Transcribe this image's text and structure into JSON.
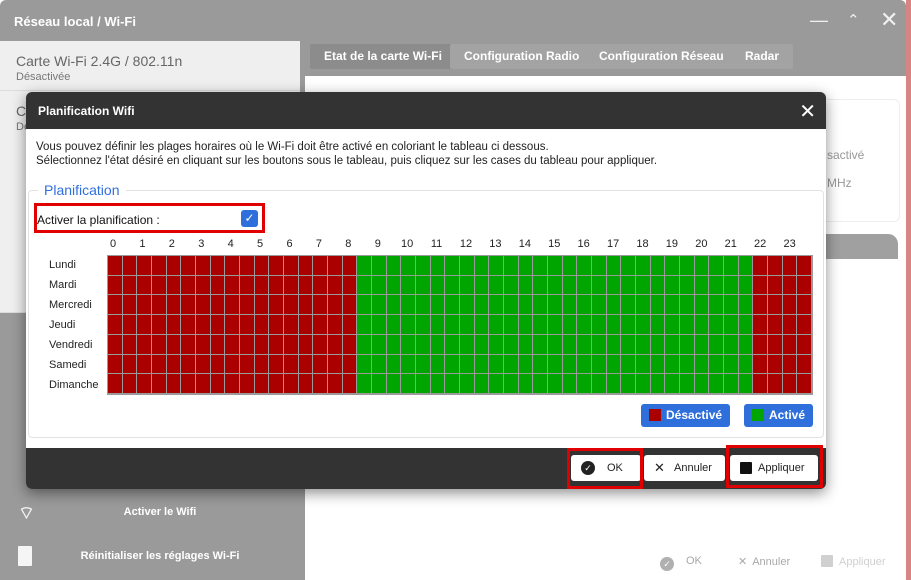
{
  "window": {
    "title": "Réseau local / Wi-Fi",
    "controls": [
      "minimize-icon",
      "restore-icon",
      "close-icon"
    ]
  },
  "sidebar": {
    "items": [
      {
        "title": "Carte Wi-Fi 2.4G / 802.11n",
        "subtitle": "Désactivée"
      },
      {
        "title": "C",
        "subtitle": "De"
      }
    ],
    "actions": [
      {
        "label": "Activer le Wifi",
        "icon": "wifi-off-icon"
      },
      {
        "label": "Réinitialiser les réglages Wi-Fi",
        "icon": "trash-icon"
      }
    ]
  },
  "tabs": [
    {
      "label": "Etat de la carte Wi-Fi",
      "active": true
    },
    {
      "label": "Configuration Radio",
      "active": false
    },
    {
      "label": "Configuration Réseau",
      "active": false
    },
    {
      "label": "Radar",
      "active": false
    }
  ],
  "background_content": {
    "status_fragment": "sactivé",
    "freq_fragment": "MHz",
    "footer": {
      "ok": "OK",
      "cancel": "Annuler",
      "apply": "Appliquer"
    }
  },
  "modal": {
    "title": "Planification Wifi",
    "description_line1": "Vous pouvez définir les plages horaires où le Wi-Fi doit être activé en coloriant le tableau ci dessous.",
    "description_line2": "Sélectionnez l'état désiré en cliquant sur les boutons sous le tableau, puis cliquez sur les cases du tableau pour appliquer.",
    "section_title": "Planification",
    "enable_label": "Activer la planification :",
    "enable_checked": true,
    "hours": [
      "0",
      "1",
      "2",
      "3",
      "4",
      "5",
      "6",
      "7",
      "8",
      "9",
      "10",
      "11",
      "12",
      "13",
      "14",
      "15",
      "16",
      "17",
      "18",
      "19",
      "20",
      "21",
      "22",
      "23"
    ],
    "days": [
      "Lundi",
      "Mardi",
      "Mercredi",
      "Jeudi",
      "Vendredi",
      "Samedi",
      "Dimanche"
    ],
    "slots_per_hour": 2,
    "schedule": {
      "description": "Same schedule every day: disabled 00:00–08:30, enabled 08:30–22:00, disabled 22:00–24:00",
      "enabled_ranges": [
        [
          8.5,
          22.0
        ]
      ]
    },
    "colors": {
      "disabled": "#aa0000",
      "enabled": "#00a500",
      "accent": "#2f6fdc"
    },
    "state_buttons": {
      "disabled": "Désactivé",
      "enabled": "Activé"
    },
    "footer": {
      "ok": "OK",
      "cancel": "Annuler",
      "apply": "Appliquer"
    }
  }
}
